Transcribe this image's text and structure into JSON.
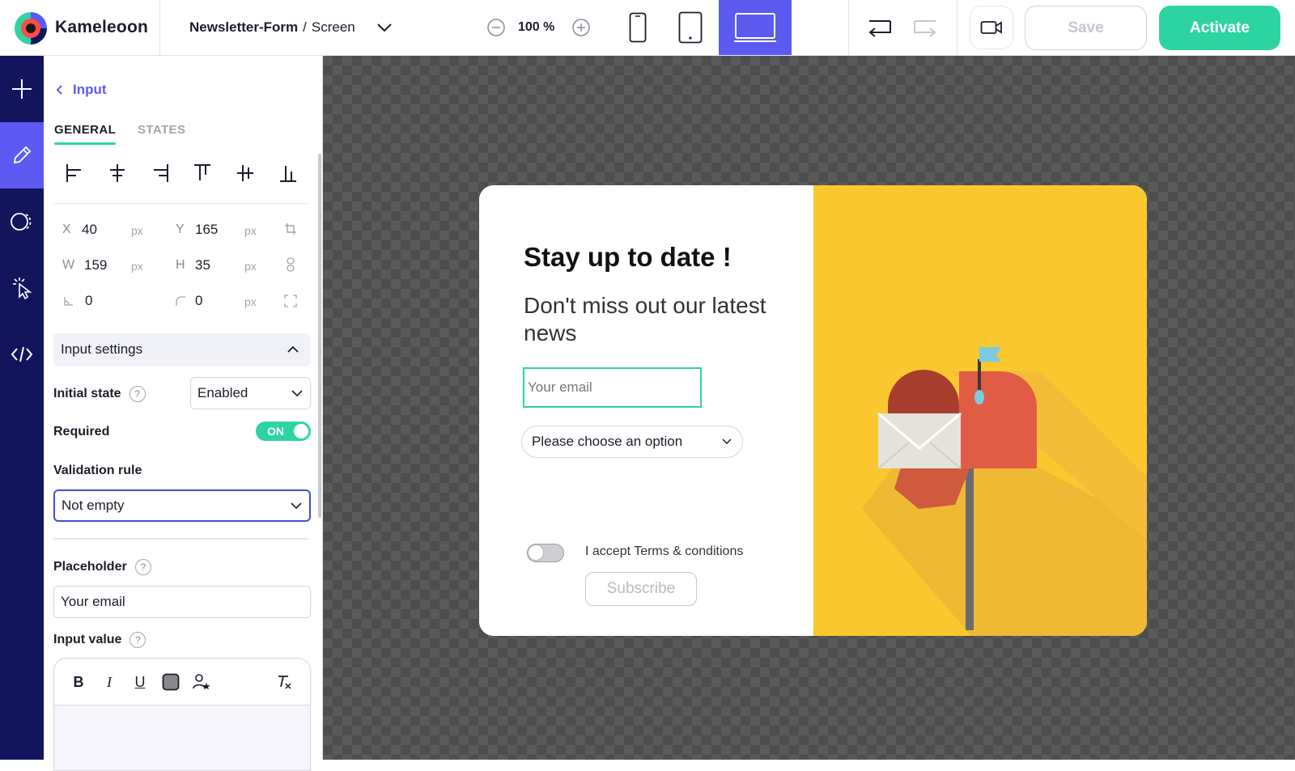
{
  "app": {
    "brand": "Kameleoon"
  },
  "breadcrumb": {
    "project": "Newsletter-Form",
    "separator": "/",
    "view": "Screen"
  },
  "zoom": {
    "value": "100 %"
  },
  "devices": [
    "mobile",
    "tablet",
    "desktop"
  ],
  "devices_selected": "desktop",
  "actions": {
    "save_label": "Save",
    "activate_label": "Activate"
  },
  "colors": {
    "accent": "#2dd4a2",
    "primary": "#5b5bf2",
    "rail": "#12145c",
    "popup_image_bg": "#fbc72e"
  },
  "rail": {
    "items": [
      {
        "icon": "plus-icon"
      },
      {
        "icon": "pencil-icon",
        "active": true
      },
      {
        "icon": "shapes-icon"
      },
      {
        "icon": "pointer-click-icon"
      },
      {
        "icon": "code-icon"
      }
    ]
  },
  "panel": {
    "back_label": "Input",
    "tabs": [
      "GENERAL",
      "STATES"
    ],
    "active_tab": "GENERAL",
    "geometry": {
      "x_label": "X",
      "x_value": "40",
      "x_unit": "px",
      "y_label": "Y",
      "y_value": "165",
      "y_unit": "px",
      "w_label": "W",
      "w_value": "159",
      "w_unit": "px",
      "h_label": "H",
      "h_value": "35",
      "h_unit": "px",
      "rotation_value": "0",
      "radius_value": "0",
      "radius_unit": "px"
    },
    "input_settings": {
      "title": "Input settings",
      "initial_state_label": "Initial state",
      "initial_state_value": "Enabled",
      "required_label": "Required",
      "required_toggle": "ON",
      "validation_label": "Validation rule",
      "validation_value": "Not empty",
      "placeholder_label": "Placeholder",
      "placeholder_value": "Your email",
      "input_value_label": "Input value"
    },
    "rte_tools": [
      "B",
      "I",
      "U"
    ]
  },
  "popup": {
    "title": "Stay up to date !",
    "subtitle": "Don't miss out our latest news",
    "email_placeholder": "Your email",
    "select_value": "Please choose an option",
    "terms_label": "I accept Terms & conditions",
    "subscribe_label": "Subscribe"
  }
}
